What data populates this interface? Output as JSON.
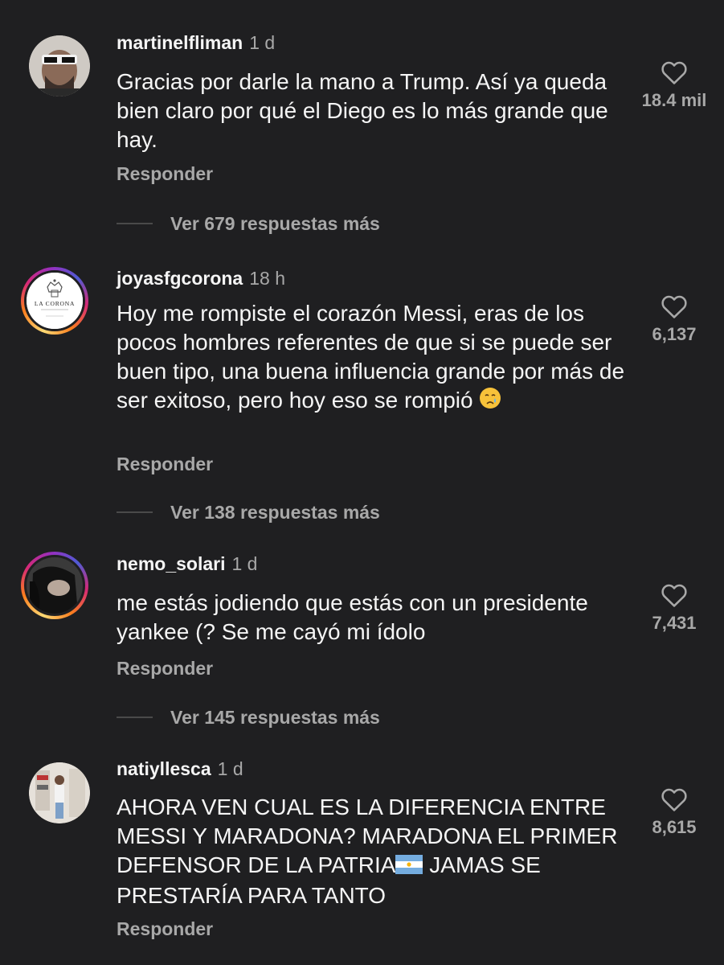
{
  "comments": [
    {
      "username": "martinelfliman",
      "time": "1 d",
      "text": "Gracias por darle la mano a Trump. Así ya queda bien claro por qué el Diego es lo más grande que hay.",
      "likes": "18.4 mil",
      "reply_label": "Responder",
      "more_replies": "Ver 679 respuestas más"
    },
    {
      "username": "joyasfgcorona",
      "time": "18 h",
      "text": "Hoy me rompiste el corazón Messi, eras de los pocos hombres referentes de que si se puede ser buen tipo, una buena influencia grande por más de ser exitoso, pero hoy eso se rompió",
      "likes": "6,137",
      "reply_label": "Responder",
      "more_replies": "Ver 138 respuestas más",
      "avatar_text": "LA CORONA"
    },
    {
      "username": "nemo_solari",
      "time": "1 d",
      "text": "me estás jodiendo que estás con un presidente yankee (? Se me cayó mi ídolo",
      "likes": "7,431",
      "reply_label": "Responder",
      "more_replies": "Ver 145 respuestas más"
    },
    {
      "username": "natiyllesca",
      "time": "1 d",
      "text": "AHORA VEN CUAL ES LA DIFERENCIA ENTRE MESSI Y MARADONA? MARADONA EL PRIMER DEFENSOR DE LA PATRIA",
      "text2": "JAMAS SE PRESTARÍA PARA TANTO",
      "likes": "8,615",
      "reply_label": "Responder"
    }
  ],
  "icons": {
    "like": "heart-outline-icon",
    "crying_emoji": "crying-face-emoji",
    "flag": "argentina-flag-emoji"
  },
  "colors": {
    "background": "#1f1f21",
    "primary_text": "#f5f5f5",
    "secondary_text": "#a8a8a8"
  }
}
